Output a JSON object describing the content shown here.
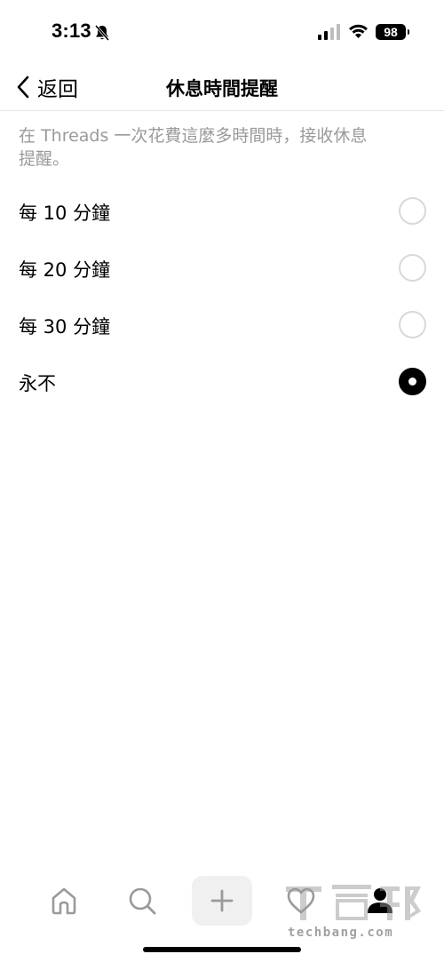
{
  "status_bar": {
    "time": "3:13",
    "battery": "98",
    "icons": [
      "bell-slash-icon",
      "cellular-signal-icon",
      "wifi-icon",
      "battery-icon"
    ]
  },
  "header": {
    "back_label": "返回",
    "title": "休息時間提醒"
  },
  "description": "在 Threads 一次花費這麼多時間時，接收休息提醒。",
  "options": [
    {
      "label": "每 10 分鐘",
      "selected": false
    },
    {
      "label": "每 20 分鐘",
      "selected": false
    },
    {
      "label": "每 30 分鐘",
      "selected": false
    },
    {
      "label": "永不",
      "selected": true
    }
  ],
  "tab_bar": {
    "items": [
      "home-icon",
      "search-icon",
      "plus-icon",
      "heart-icon",
      "profile-icon"
    ]
  },
  "watermark": {
    "text": "techbang.com"
  },
  "colors": {
    "text": "#000000",
    "secondary_text": "#9a9a9a",
    "radio_border": "#d9d9d9",
    "create_button_bg": "#f0f0f0"
  }
}
